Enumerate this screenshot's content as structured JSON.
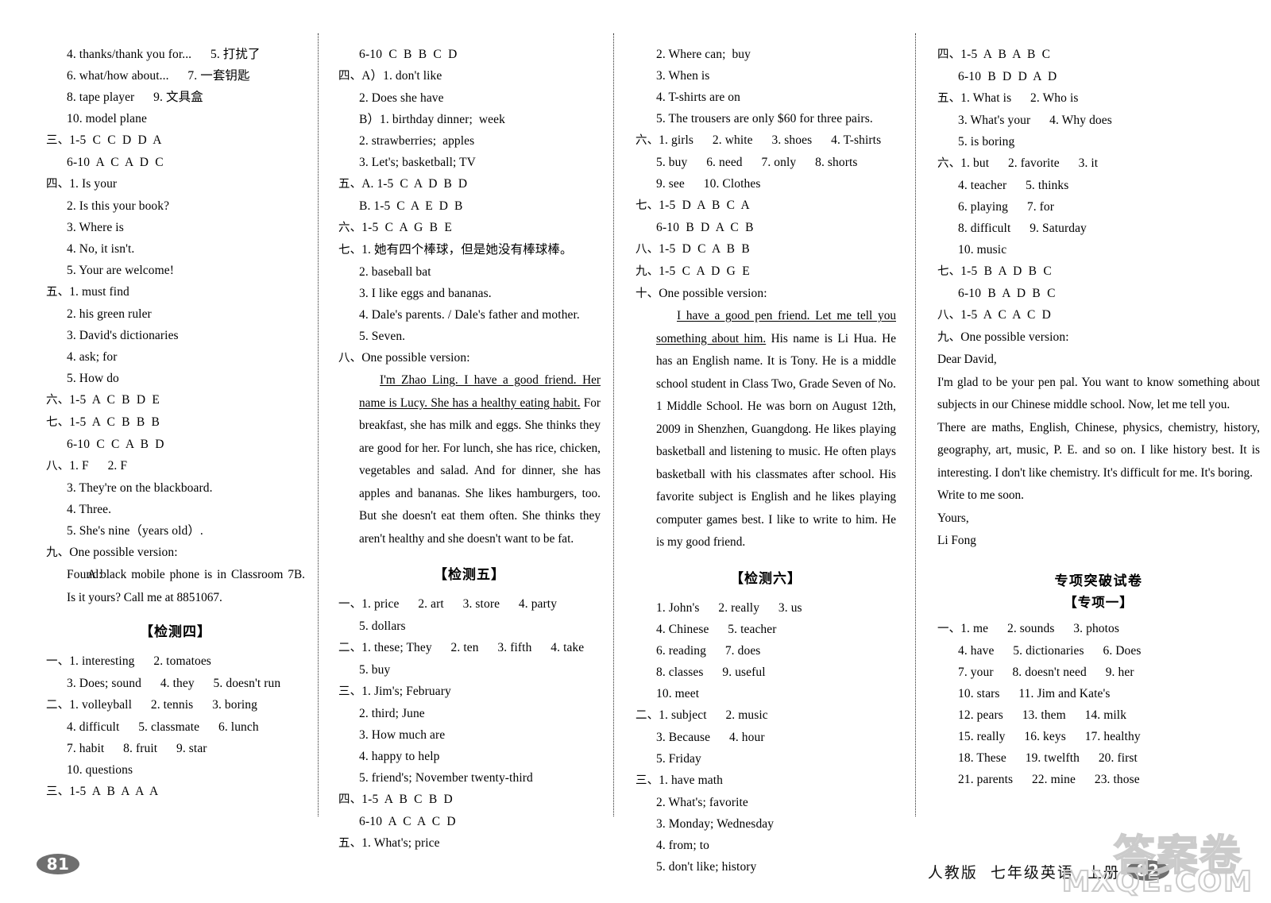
{
  "document": {
    "footer_label": "人教版  七年级英语  上册",
    "page_left": "81",
    "page_right": "82",
    "watermark_cn": "答案卷",
    "watermark_en": "MXQE.COM"
  },
  "headings": {
    "test4": "【检测四】",
    "test5": "【检测五】",
    "test6": "【检测六】",
    "special_main": "专项突破试卷",
    "special_sub": "【专项一】"
  },
  "col1": [
    {
      "marker": "",
      "text": "4. thanks/thank you for...      5. 打扰了"
    },
    {
      "marker": "",
      "text": "6. what/how about...      7. 一套钥匙"
    },
    {
      "marker": "",
      "text": "8. tape player      9. 文具盒"
    },
    {
      "marker": "",
      "text": "10. model plane"
    },
    {
      "marker": "三、",
      "text": "1-5  C  C  D  D  A"
    },
    {
      "marker": "",
      "text": "6-10  A  C  A  D  C"
    },
    {
      "marker": "四、",
      "text": "1. Is your"
    },
    {
      "marker": "",
      "text": "2. Is this your book?"
    },
    {
      "marker": "",
      "text": "3. Where is"
    },
    {
      "marker": "",
      "text": "4. No, it isn't."
    },
    {
      "marker": "",
      "text": "5. Your are welcome!"
    },
    {
      "marker": "五、",
      "text": "1. must find"
    },
    {
      "marker": "",
      "text": "2. his green ruler"
    },
    {
      "marker": "",
      "text": "3. David's dictionaries"
    },
    {
      "marker": "",
      "text": "4. ask; for"
    },
    {
      "marker": "",
      "text": "5. How do"
    },
    {
      "marker": "六、",
      "text": "1-5  A  C  B  D  E"
    },
    {
      "marker": "七、",
      "text": "1-5  A  C  B  B  B"
    },
    {
      "marker": "",
      "text": "6-10  C  C  A  B  D"
    },
    {
      "marker": "八、",
      "text": "1. F      2. F"
    },
    {
      "marker": "",
      "text": "3. They're on the blackboard."
    },
    {
      "marker": "",
      "text": "4. Three."
    },
    {
      "marker": "",
      "text": "5. She's nine（years old）."
    },
    {
      "marker": "九、",
      "text": "One possible version:"
    },
    {
      "marker": "",
      "text": "Found:"
    }
  ],
  "col1_para": "A black mobile phone is in Classroom 7B. Is it yours? Call me at 8851067.",
  "col1_after": [
    {
      "marker": "一、",
      "text": "1. interesting      2. tomatoes"
    },
    {
      "marker": "",
      "text": "3. Does; sound      4. they      5. doesn't run"
    },
    {
      "marker": "二、",
      "text": "1. volleyball      2. tennis      3. boring"
    },
    {
      "marker": "",
      "text": "4. difficult      5. classmate      6. lunch"
    },
    {
      "marker": "",
      "text": "7. habit      8. fruit      9. star"
    },
    {
      "marker": "",
      "text": "10. questions"
    },
    {
      "marker": "三、",
      "text": "1-5  A  B  A  A  A"
    }
  ],
  "col2": [
    {
      "marker": "",
      "text": "6-10  C  B  B  C  D"
    },
    {
      "marker": "四、",
      "text": "A）1. don't like"
    },
    {
      "marker": "",
      "text": "2. Does she have"
    },
    {
      "marker": "",
      "text": "B）1. birthday dinner;  week"
    },
    {
      "marker": "",
      "text": "2. strawberries;  apples"
    },
    {
      "marker": "",
      "text": "3. Let's; basketball; TV"
    },
    {
      "marker": "五、",
      "text": "A. 1-5  C  A  D  B  D"
    },
    {
      "marker": "",
      "text": "B. 1-5  C  A  E  D  B"
    },
    {
      "marker": "六、",
      "text": "1-5  C  A  G  B  E"
    },
    {
      "marker": "七、",
      "text": "1. 她有四个棒球，但是她没有棒球棒。"
    },
    {
      "marker": "",
      "text": "2. baseball bat"
    },
    {
      "marker": "",
      "text": "3. I like eggs and bananas."
    },
    {
      "marker": "",
      "text": "4. Dale's parents. / Dale's father and mother."
    },
    {
      "marker": "",
      "text": "5. Seven."
    },
    {
      "marker": "八、",
      "text": "One possible version:"
    }
  ],
  "col2_para_u": "I'm Zhao Ling. I have a good friend. Her name is Lucy. She has a healthy eating habit.",
  "col2_para_rest": " For breakfast, she has milk and eggs. She thinks they are good for her. For lunch, she has rice, chicken, vegetables and salad. And for dinner, she has apples and bananas. She likes hamburgers, too. But she doesn't eat them often. She thinks they aren't healthy and she doesn't want to be fat.",
  "col2_after": [
    {
      "marker": "一、",
      "text": "1. price      2. art      3. store      4. party"
    },
    {
      "marker": "",
      "text": "5. dollars"
    },
    {
      "marker": "二、",
      "text": "1. these; They      2. ten      3. fifth      4. take"
    },
    {
      "marker": "",
      "text": "5. buy"
    },
    {
      "marker": "三、",
      "text": "1. Jim's; February"
    },
    {
      "marker": "",
      "text": "2. third; June"
    },
    {
      "marker": "",
      "text": "3. How much are"
    },
    {
      "marker": "",
      "text": "4. happy to help"
    },
    {
      "marker": "",
      "text": "5. friend's; November twenty-third"
    },
    {
      "marker": "四、",
      "text": "1-5  A  B  C  B  D"
    },
    {
      "marker": "",
      "text": "6-10  A  C  A  C  D"
    },
    {
      "marker": "五、",
      "text": "1. What's; price"
    }
  ],
  "col3": [
    {
      "marker": "",
      "text": "2. Where can;  buy"
    },
    {
      "marker": "",
      "text": "3. When is"
    },
    {
      "marker": "",
      "text": "4. T-shirts are on"
    },
    {
      "marker": "",
      "text": "5. The trousers are only $60 for three pairs."
    },
    {
      "marker": "六、",
      "text": "1. girls      2. white      3. shoes      4. T-shirts"
    },
    {
      "marker": "",
      "text": "5. buy      6. need      7. only      8. shorts"
    },
    {
      "marker": "",
      "text": "9. see      10. Clothes"
    },
    {
      "marker": "七、",
      "text": "1-5  D  A  B  C  A"
    },
    {
      "marker": "",
      "text": "6-10  B  D  A  C  B"
    },
    {
      "marker": "八、",
      "text": "1-5  D  C  A  B  B"
    },
    {
      "marker": "九、",
      "text": "1-5  C  A  D  G  E"
    },
    {
      "marker": "十、",
      "text": "One possible version:"
    }
  ],
  "col3_para_u": "I have a good pen friend. Let me tell you something about him.",
  "col3_para_rest": " His name is Li Hua. He has an English name. It is Tony. He is a middle school student in Class Two, Grade Seven of No. 1 Middle School. He was born on August 12th, 2009 in Shenzhen, Guangdong.  He likes playing basketball and listening to music. He often plays basketball with his classmates after school. His favorite subject is English and he likes playing computer games best. I like to write to him. He is my good friend.",
  "col3_after": [
    {
      "marker": "",
      "text": "1. John's      2. really      3. us"
    },
    {
      "marker": "",
      "text": "4. Chinese      5. teacher"
    },
    {
      "marker": "",
      "text": "6. reading      7. does"
    },
    {
      "marker": "",
      "text": "8. classes      9. useful"
    },
    {
      "marker": "",
      "text": "10. meet"
    },
    {
      "marker": "二、",
      "text": "1. subject      2. music"
    },
    {
      "marker": "",
      "text": "3. Because      4. hour"
    },
    {
      "marker": "",
      "text": "5. Friday"
    },
    {
      "marker": "三、",
      "text": "1. have math"
    },
    {
      "marker": "",
      "text": "2. What's; favorite"
    },
    {
      "marker": "",
      "text": "3. Monday; Wednesday"
    },
    {
      "marker": "",
      "text": "4. from; to"
    },
    {
      "marker": "",
      "text": "5. don't like; history"
    }
  ],
  "col4": [
    {
      "marker": "四、",
      "text": "1-5  A  B  A  B  C"
    },
    {
      "marker": "",
      "text": "6-10  B  D  D  A  D"
    },
    {
      "marker": "五、",
      "text": "1. What is      2. Who is"
    },
    {
      "marker": "",
      "text": "3. What's your      4. Why does"
    },
    {
      "marker": "",
      "text": "5. is boring"
    },
    {
      "marker": "六、",
      "text": "1. but      2. favorite      3. it"
    },
    {
      "marker": "",
      "text": "4. teacher      5. thinks"
    },
    {
      "marker": "",
      "text": "6. playing      7. for"
    },
    {
      "marker": "",
      "text": "8. difficult      9. Saturday"
    },
    {
      "marker": "",
      "text": "10. music"
    },
    {
      "marker": "七、",
      "text": "1-5  B  A  D  B  C"
    },
    {
      "marker": "",
      "text": "6-10  B  A  D  B  C"
    },
    {
      "marker": "八、",
      "text": "1-5  A  C  A  C  D"
    },
    {
      "marker": "九、",
      "text": "One possible version:"
    }
  ],
  "col4_letter": [
    "Dear David,",
    "I'm glad to be your pen pal. You want to know something about subjects in our Chinese middle school. Now, let me tell you.",
    "There are maths, English, Chinese, physics, chemistry, history, geography, art, music, P. E. and so on. I like history best. It is interesting. I don't like chemistry. It's difficult for me. It's boring.",
    "Write to me soon.",
    "Yours,",
    "Li Fong"
  ],
  "col4_after": [
    {
      "marker": "一、",
      "text": "1. me      2. sounds      3. photos"
    },
    {
      "marker": "",
      "text": "4. have      5. dictionaries      6. Does"
    },
    {
      "marker": "",
      "text": "7. your      8. doesn't need      9. her"
    },
    {
      "marker": "",
      "text": "10. stars      11. Jim and Kate's"
    },
    {
      "marker": "",
      "text": "12. pears      13. them      14. milk"
    },
    {
      "marker": "",
      "text": "15. really      16. keys      17. healthy"
    },
    {
      "marker": "",
      "text": "18. These      19. twelfth      20. first"
    },
    {
      "marker": "",
      "text": "21. parents      22. mine      23. those"
    }
  ]
}
